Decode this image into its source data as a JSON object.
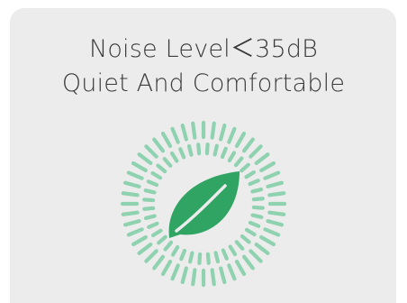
{
  "headline": {
    "line1": "Noise Level＜35dB",
    "line2": "Quiet And Comfortable"
  },
  "badge": {
    "icon": "leaf-icon",
    "ring_color": "#8fd2b0",
    "leaf_color": "#2fa463"
  },
  "colors": {
    "card_background": "#ececec",
    "text": "#3a3a3a"
  }
}
